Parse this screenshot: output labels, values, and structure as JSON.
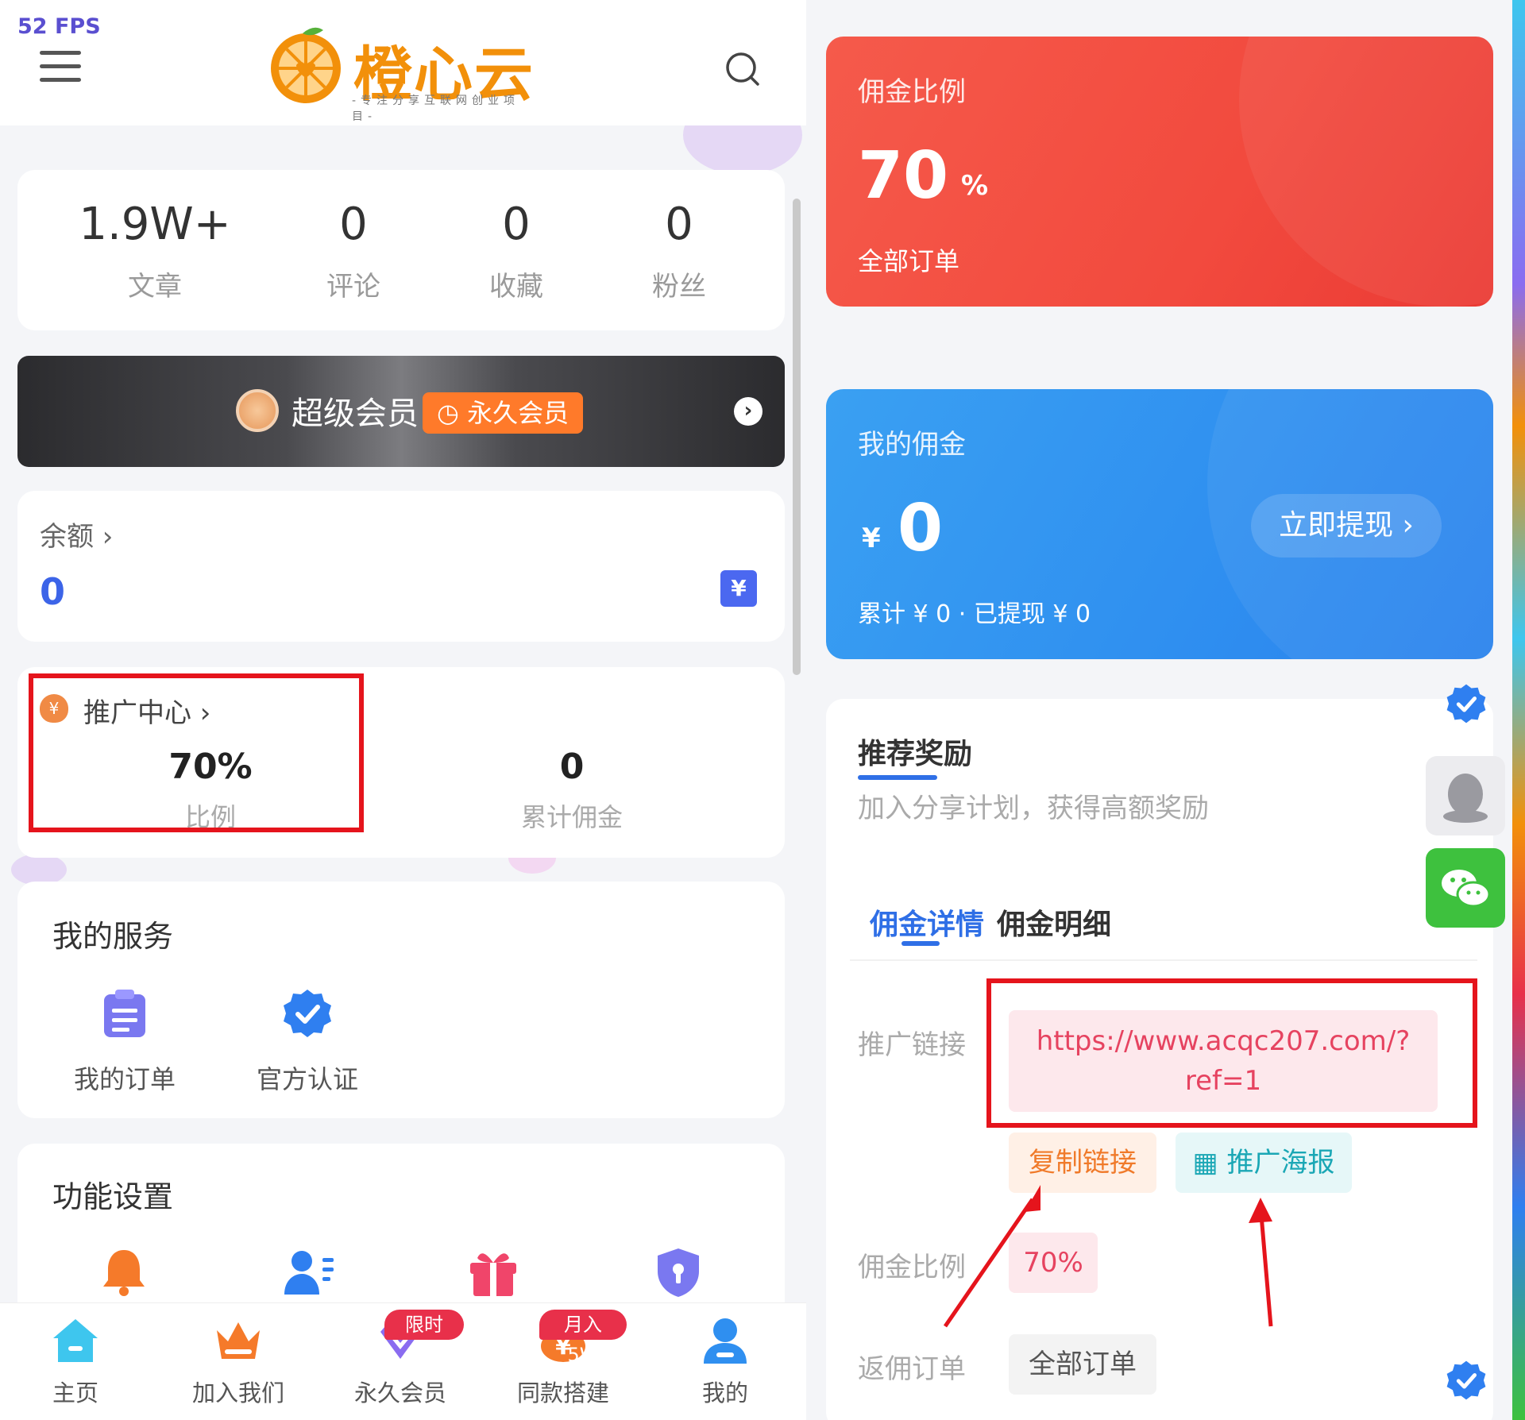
{
  "fps": "52 FPS",
  "brand": {
    "name": "橙心云",
    "tagline": "-专注分享互联网创业项目-",
    "accent": "#f2900a"
  },
  "stats": [
    {
      "value": "1.9W+",
      "label": "文章"
    },
    {
      "value": "0",
      "label": "评论"
    },
    {
      "value": "0",
      "label": "收藏"
    },
    {
      "value": "0",
      "label": "粉丝"
    }
  ],
  "vip": {
    "title": "超级会员",
    "badge": "永久会员",
    "badge_icon": "clock-icon",
    "arrow": "›"
  },
  "balance": {
    "label": "余额 ›",
    "value": "0",
    "icon_glyph": "¥"
  },
  "promo": {
    "label": "推广中心 ›",
    "icon_glyph": "¥",
    "ratio_value": "70%",
    "ratio_label": "比例",
    "commission_value": "0",
    "commission_label": "累计佣金"
  },
  "services": {
    "title": "我的服务",
    "items": [
      {
        "label": "我的订单",
        "icon": "clipboard-icon"
      },
      {
        "label": "官方认证",
        "icon": "verified-badge-icon"
      }
    ]
  },
  "settings": {
    "title": "功能设置",
    "icons": [
      "bell-icon",
      "user-list-icon",
      "gift-icon",
      "shield-icon"
    ]
  },
  "tabbar": [
    {
      "label": "主页",
      "icon": "home-icon"
    },
    {
      "label": "加入我们",
      "icon": "crown-icon"
    },
    {
      "label": "永久会员",
      "icon": "diamond-icon",
      "badge": "限时99"
    },
    {
      "label": "同款搭建",
      "icon": "coin-icon",
      "badge": "月入5W"
    },
    {
      "label": "我的",
      "icon": "user-icon"
    }
  ],
  "commission_rate_card": {
    "label": "佣金比例",
    "value": "70",
    "unit": "%",
    "sub": "全部订单",
    "color": "#f24a3e"
  },
  "my_commission_card": {
    "label": "我的佣金",
    "currency": "¥",
    "value": "0",
    "withdraw_button": "立即提现 ›",
    "sub": "累计 ¥ 0 · 已提现 ¥ 0",
    "color": "#2f8ff0"
  },
  "referral": {
    "title": "推荐奖励",
    "desc": "加入分享计划，获得高额奖励",
    "tabs": [
      "佣金详情",
      "佣金明细"
    ],
    "link_label": "推广链接",
    "link_line1": "https://www.acqc207.com/?",
    "link_line2": "ref=1",
    "copy_button": "复制链接",
    "poster_button": "推广海报",
    "rate_label": "佣金比例",
    "rate_value": "70%",
    "orders_label": "返佣订单",
    "orders_value": "全部订单"
  }
}
